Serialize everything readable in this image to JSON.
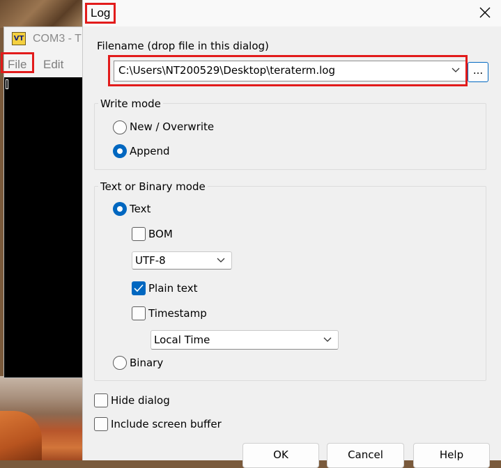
{
  "background_window": {
    "title": "COM3 - T",
    "icon_text": "VT",
    "menu": {
      "file": "File",
      "edit": "Edit"
    }
  },
  "dialog": {
    "title": "Log",
    "filename": {
      "label": "Filename (drop file in this dialog)",
      "value": "C:\\Users\\NT200529\\Desktop\\teraterm.log",
      "browse_label": "..."
    },
    "write_mode": {
      "label": "Write mode",
      "options": [
        {
          "label": "New / Overwrite",
          "selected": false
        },
        {
          "label": "Append",
          "selected": true
        }
      ]
    },
    "text_binary_mode": {
      "label": "Text or Binary mode",
      "text": {
        "label": "Text",
        "selected": true
      },
      "bom": {
        "label": "BOM",
        "checked": false
      },
      "encoding": {
        "value": "UTF-8"
      },
      "plain_text": {
        "label": "Plain text",
        "checked": true
      },
      "timestamp": {
        "label": "Timestamp",
        "checked": false
      },
      "timestamp_format": {
        "value": "Local Time"
      },
      "binary": {
        "label": "Binary",
        "selected": false
      }
    },
    "hide_dialog": {
      "label": "Hide dialog",
      "checked": false
    },
    "include_screen_buffer": {
      "label": "Include screen buffer",
      "checked": false
    },
    "buttons": {
      "ok": "OK",
      "cancel": "Cancel",
      "help": "Help"
    }
  },
  "colors": {
    "accent": "#0067c0",
    "highlight": "#e21b1b"
  }
}
